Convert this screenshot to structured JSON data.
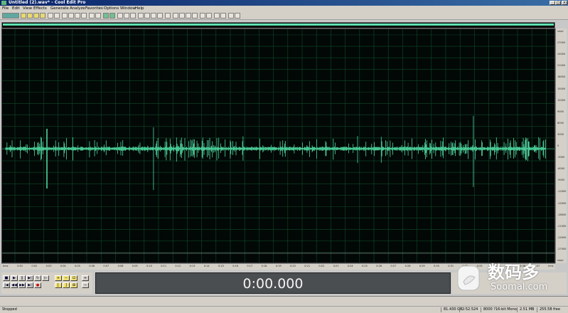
{
  "window": {
    "title": "Untitled (2).wav* - Cool Edit Pro"
  },
  "menu": [
    "File",
    "Edit",
    "View",
    "Effects",
    "Generate",
    "Analyze",
    "Favorites",
    "Options",
    "Window",
    "Help"
  ],
  "timeline": {
    "labels": [
      "hms",
      "0:01",
      "0:02",
      "0:03",
      "0:04",
      "0:05",
      "0:06",
      "0:07",
      "0:08",
      "0:09",
      "0:10",
      "0:11",
      "0:12",
      "0:13",
      "0:14",
      "0:15",
      "0:16",
      "0:17",
      "0:18",
      "0:19",
      "0:20",
      "0:21",
      "0:22",
      "0:23",
      "0:24",
      "0:25",
      "0:26",
      "0:27",
      "0:28",
      "0:29",
      "0:30",
      "0:31",
      "0:32",
      "0:33",
      "0:34",
      "0:35",
      "0:36",
      "0:37",
      "hms"
    ]
  },
  "ruler_right": {
    "labels": [
      "smpl",
      "27000",
      "24000",
      "21000",
      "18000",
      "15000",
      "12000",
      "9000",
      "6000",
      "3000",
      "0",
      "-3000",
      "-6000",
      "-9000",
      "-12000",
      "-15000",
      "-18000",
      "-21000",
      "-24000",
      "-27000",
      "smpl"
    ]
  },
  "time_display": {
    "value": "0:00.000"
  },
  "statusbar": {
    "state": "Stopped",
    "free_space": "81.430 GB",
    "time_free": "2:52.524",
    "format": "8000 ?16-bit Mono",
    "size": "2.51 MB",
    "disk": "255.58 free"
  },
  "watermark": {
    "chinese": "数码多",
    "site": "Soomal.com"
  },
  "colors": {
    "waveform": "#4fd8a0",
    "background": "#020806",
    "grid": "#0f4a2a"
  }
}
